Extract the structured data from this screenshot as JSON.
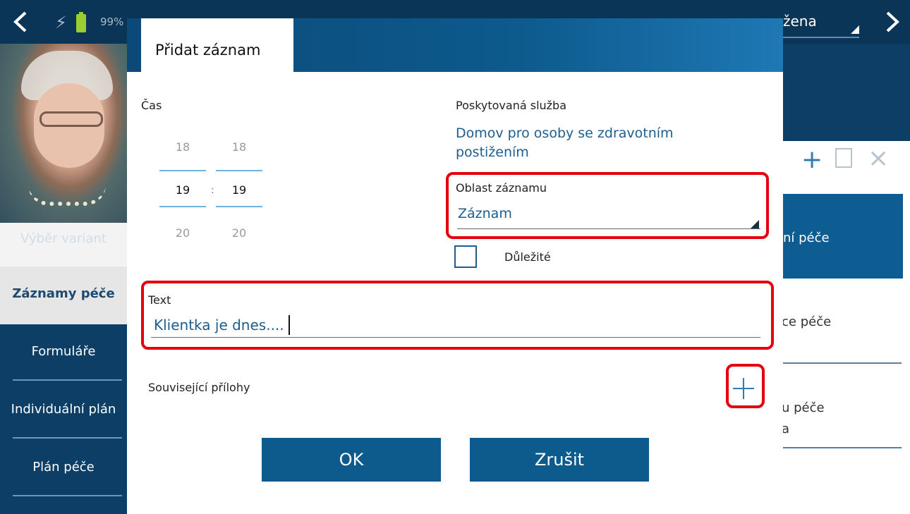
{
  "topbar": {
    "battery_pct": "99%",
    "client_name": "žena"
  },
  "sidebar": {
    "items": [
      {
        "label": "Výběr variant"
      },
      {
        "label": "Záznamy péče"
      },
      {
        "label": "Formuláře"
      },
      {
        "label": "Individuální plán"
      },
      {
        "label": "Plán péče"
      }
    ]
  },
  "right_panel": {
    "card_text": "ní péče",
    "item1": "ce péče",
    "item2_line1": "u péče",
    "item2_line2": "a"
  },
  "dialog": {
    "title": "Přidat záznam",
    "time": {
      "label": "Čas",
      "hours_prev": "18",
      "hours_cur": "19",
      "hours_next": "20",
      "minutes_prev": "18",
      "minutes_cur": "19",
      "minutes_next": "20",
      "separator": ":"
    },
    "service": {
      "label": "Poskytovaná služba",
      "value_line1": "Domov pro osoby se zdravotním",
      "value_line2": "postižením"
    },
    "area": {
      "label": "Oblast záznamu",
      "value": "Záznam"
    },
    "important": {
      "label": "Důležité",
      "checked": false
    },
    "text": {
      "label": "Text",
      "value": "Klientka je dnes...."
    },
    "attachments": {
      "label": "Související přílohy"
    },
    "buttons": {
      "ok": "OK",
      "cancel": "Zrušit"
    }
  },
  "colors": {
    "primary": "#0d5a8d",
    "accent_text": "#1d5e8f",
    "highlight": "#e3000f",
    "background": "#0d3f66"
  }
}
